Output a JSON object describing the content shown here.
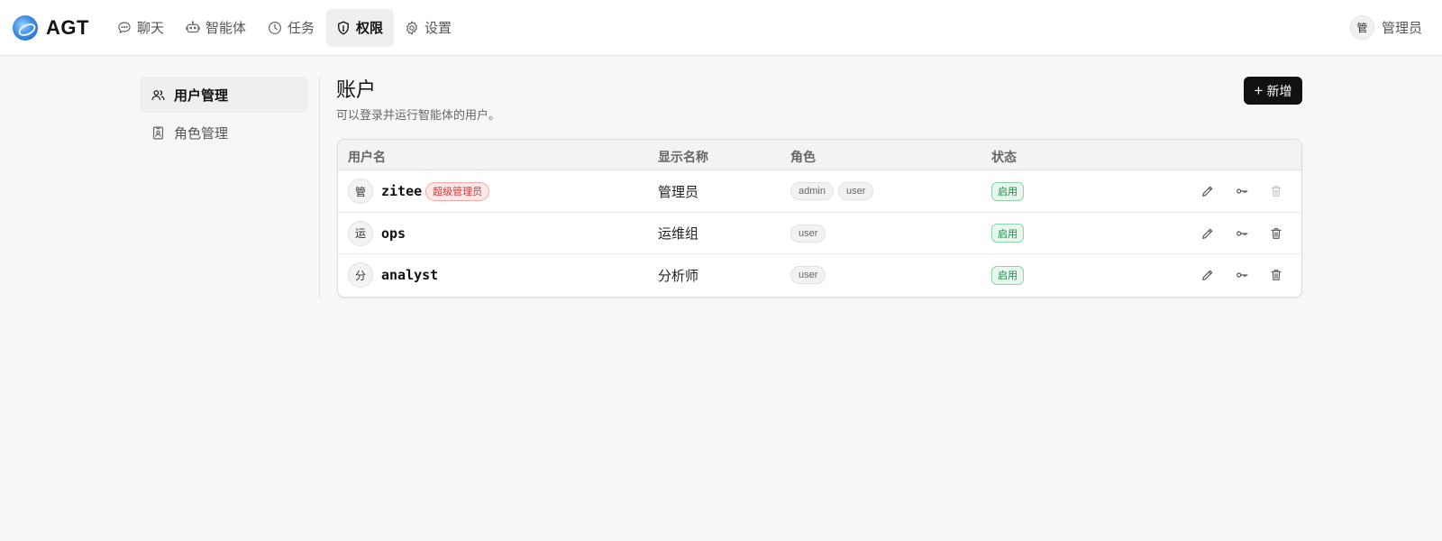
{
  "app": {
    "brand": "AGT"
  },
  "nav": {
    "items": [
      {
        "label": "聊天",
        "icon": "chat-bubble-icon"
      },
      {
        "label": "智能体",
        "icon": "robot-icon"
      },
      {
        "label": "任务",
        "icon": "clock-icon"
      },
      {
        "label": "权限",
        "icon": "shield-icon",
        "active": true
      },
      {
        "label": "设置",
        "icon": "gear-icon"
      }
    ]
  },
  "user": {
    "avatar": "管",
    "name": "管理员"
  },
  "sidebar": {
    "items": [
      {
        "label": "用户管理",
        "icon": "users-icon",
        "active": true
      },
      {
        "label": "角色管理",
        "icon": "id-badge-icon"
      }
    ]
  },
  "main": {
    "title": "账户",
    "subtitle": "可以登录并运行智能体的用户。",
    "add_button": {
      "plus": "+",
      "label": "新增"
    }
  },
  "table": {
    "columns": [
      "用户名",
      "显示名称",
      "角色",
      "状态"
    ],
    "rows": [
      {
        "avatar": "管",
        "username": "zitee",
        "badge": "超级管理员",
        "display_name": "管理员",
        "roles": [
          "admin",
          "user"
        ],
        "status": "启用",
        "delete_disabled": true
      },
      {
        "avatar": "运",
        "username": "ops",
        "badge": "",
        "display_name": "运维组",
        "roles": [
          "user"
        ],
        "status": "启用",
        "delete_disabled": false
      },
      {
        "avatar": "分",
        "username": "analyst",
        "badge": "",
        "display_name": "分析师",
        "roles": [
          "user"
        ],
        "status": "启用",
        "delete_disabled": false
      }
    ]
  },
  "colors": {
    "accent": "#111111",
    "status_green": "#1a8a48",
    "super_admin_red": "#d9363e"
  }
}
